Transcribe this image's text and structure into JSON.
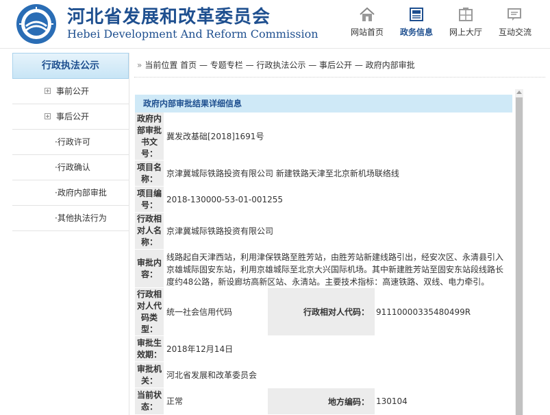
{
  "header": {
    "title_cn": "河北省发展和改革委员会",
    "title_en": "Hebei Development And Reform Commission",
    "nav": [
      {
        "label": "网站首页",
        "icon": "home-icon"
      },
      {
        "label": "政务信息",
        "icon": "document-icon"
      },
      {
        "label": "网上大厅",
        "icon": "building-icon"
      },
      {
        "label": "互动交流",
        "icon": "chat-icon"
      }
    ]
  },
  "sidebar": {
    "title": "行政执法公示",
    "items": [
      {
        "label": "事前公开",
        "type": "parent"
      },
      {
        "label": "事后公开",
        "type": "parent"
      },
      {
        "label": "·行政许可",
        "type": "child"
      },
      {
        "label": "·行政确认",
        "type": "child"
      },
      {
        "label": "·政府内部审批",
        "type": "child"
      },
      {
        "label": "·其他执法行为",
        "type": "child"
      }
    ]
  },
  "breadcrumb": {
    "raquo": "»",
    "text": "当前位置 首页 — 专题专栏 — 行政执法公示 — 事后公开 — 政府内部审批"
  },
  "panel": {
    "title": "政府内部审批结果详细信息",
    "rows": [
      {
        "label": "政府内部审批书文号：",
        "value": "冀发改基础[2018]1691号"
      },
      {
        "label": "项目名称：",
        "value": "京津冀城际铁路投资有限公司 新建铁路天津至北京新机场联络线"
      },
      {
        "label": "项目编号：",
        "value": "2018-130000-53-01-001255"
      },
      {
        "label": "行政相对人名称：",
        "value": "京津冀城际铁路投资有限公司"
      },
      {
        "label": "审批内容：",
        "value": "线路起自天津西站，利用津保铁路至胜芳站，由胜芳站新建线路引出，经安次区、永清县引入京雄城际固安东站，利用京雄城际至北京大兴国际机场。其中新建胜芳站至固安东站段线路长度约48公路，新设廊坊高新区站、永清站。主要技术指标：高速铁路、双线、电力牵引。"
      },
      {
        "label": "行政相对人代码类型：",
        "value": "统一社会信用代码",
        "sublabel": "行政相对人代码：",
        "subvalue": "91110000335480499R"
      },
      {
        "label": "审批生效期：",
        "value": "2018年12月14日"
      },
      {
        "label": "审批机关：",
        "value": "河北省发展和改革委员会"
      },
      {
        "label": "当前状态：",
        "value": "正常",
        "sublabel": "地方编码：",
        "subvalue": "130104"
      }
    ]
  },
  "colors": {
    "brand": "#1e4f8f",
    "panel_header": "#cfe9f7",
    "label_bg": "#ececec"
  }
}
